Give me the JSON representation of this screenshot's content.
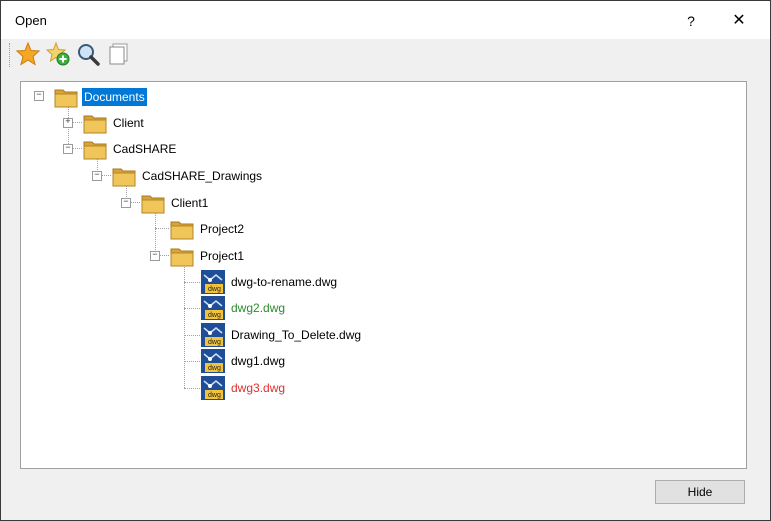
{
  "window": {
    "title": "Open",
    "help_label": "?",
    "close_label": "✕"
  },
  "toolbar": {
    "buttons": [
      {
        "name": "favorite",
        "icon": "star-icon"
      },
      {
        "name": "add-favorite",
        "icon": "star-add-icon"
      },
      {
        "name": "search",
        "icon": "magnifier-icon"
      },
      {
        "name": "copy",
        "icon": "copy-pages-icon"
      }
    ]
  },
  "tree": {
    "root": {
      "label": "Documents",
      "selected": true,
      "expanded": true
    },
    "nodes": [
      {
        "label": "Client",
        "type": "folder",
        "expanded": false
      },
      {
        "label": "CadSHARE",
        "type": "folder",
        "expanded": true
      },
      {
        "label": "CadSHARE_Drawings",
        "type": "folder",
        "expanded": true
      },
      {
        "label": "Client1",
        "type": "folder",
        "expanded": true
      },
      {
        "label": "Project2",
        "type": "folder"
      },
      {
        "label": "Project1",
        "type": "folder",
        "expanded": true
      }
    ],
    "files": [
      {
        "label": "dwg-to-rename.dwg",
        "color": "#000000"
      },
      {
        "label": "dwg2.dwg",
        "color": "#2e8b2e"
      },
      {
        "label": "Drawing_To_Delete.dwg",
        "color": "#000000"
      },
      {
        "label": "dwg1.dwg",
        "color": "#000000"
      },
      {
        "label": "dwg3.dwg",
        "color": "#e03030"
      }
    ],
    "expander_collapsed": "+",
    "expander_expanded": "−"
  },
  "footer": {
    "hide_label": "Hide"
  },
  "colors": {
    "selection": "#0078d7",
    "folder": "#e8b84a"
  }
}
